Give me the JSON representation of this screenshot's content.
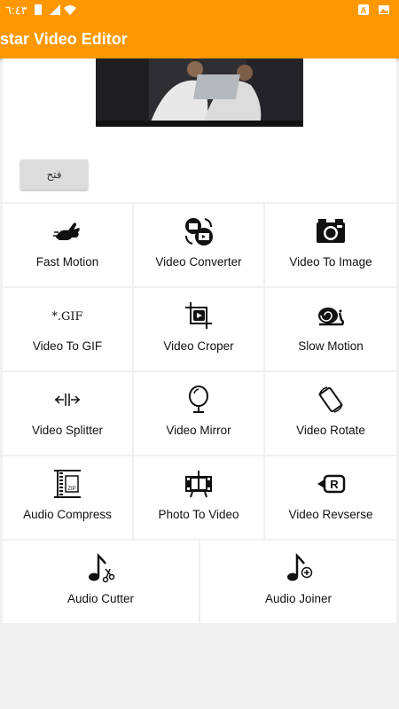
{
  "status_bar": {
    "time": "٦:٤٣"
  },
  "app_bar": {
    "title": "star Video Editor"
  },
  "open_button": {
    "label": "فتح"
  },
  "grid": [
    {
      "label": "Fast Motion",
      "icon": "rabbit-icon"
    },
    {
      "label": "Video Converter",
      "icon": "video-convert-icon"
    },
    {
      "label": "Video To Image",
      "icon": "camera-icon"
    },
    {
      "label": "Video To GIF",
      "icon": "gif-icon"
    },
    {
      "label": "Video Croper",
      "icon": "video-crop-icon"
    },
    {
      "label": "Slow Motion",
      "icon": "snail-icon"
    },
    {
      "label": "Video Splitter",
      "icon": "split-arrows-icon"
    },
    {
      "label": "Video Mirror",
      "icon": "mirror-icon"
    },
    {
      "label": "Video Rotate",
      "icon": "rotate-icon"
    },
    {
      "label": "Audio Compress",
      "icon": "compress-icon"
    },
    {
      "label": "Photo To Video",
      "icon": "film-icon"
    },
    {
      "label": "Video Revserse",
      "icon": "reverse-video-icon"
    },
    {
      "label": "Audio Cutter",
      "icon": "music-scissors-icon"
    },
    {
      "label": "Audio Joiner",
      "icon": "music-add-icon"
    }
  ]
}
